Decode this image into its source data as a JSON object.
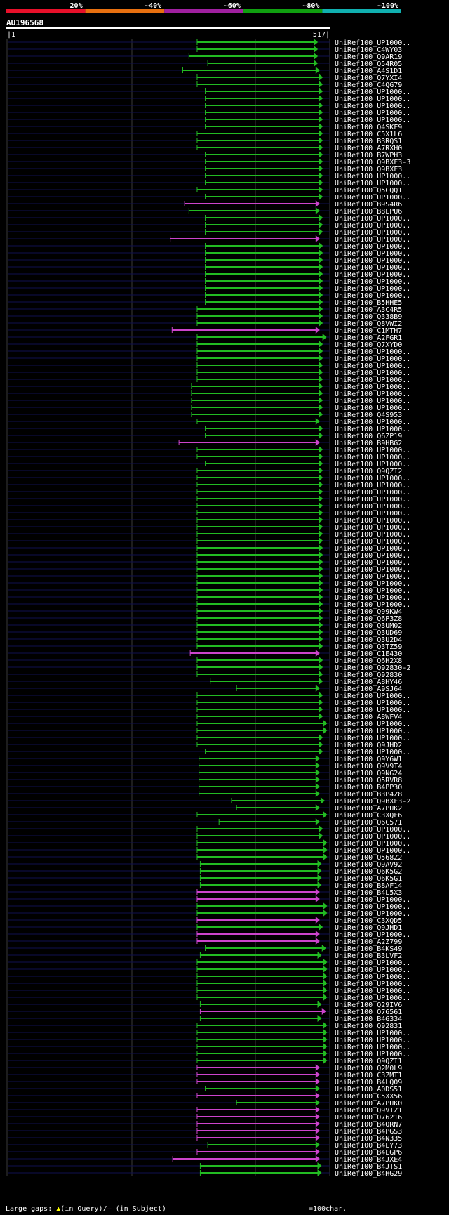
{
  "chart_data": {
    "type": "alignment_overview",
    "title": "AU196568",
    "query_start": "1",
    "query_end": "517",
    "scale_labels": [
      "20%",
      "~40%",
      "~60%",
      "~80%",
      "~100%"
    ],
    "scale_colors": [
      "#e8102a",
      "#e87010",
      "#a020a0",
      "#10a010",
      "#10b0b0"
    ],
    "hit_colors": {
      "green": "#22bb22",
      "magenta": "#cc44cc"
    },
    "rows": [
      {
        "name": "UniRef100_UP1000..",
        "s": 305,
        "e": 497,
        "c": "g"
      },
      {
        "name": "UniRef100_C4WY03",
        "s": 305,
        "e": 497,
        "c": "g"
      },
      {
        "name": "UniRef100_Q9AR19",
        "s": 292,
        "e": 497,
        "c": "g"
      },
      {
        "name": "UniRef100_Q54R05",
        "s": 322,
        "e": 497,
        "c": "g"
      },
      {
        "name": "UniRef100_A4S1D1",
        "s": 282,
        "e": 500,
        "c": "g"
      },
      {
        "name": "UniRef100_Q7YXI4",
        "s": 305,
        "e": 505,
        "c": "g"
      },
      {
        "name": "UniRef100_C4QG79",
        "s": 305,
        "e": 505,
        "c": "g"
      },
      {
        "name": "UniRef100_UP1000..",
        "s": 318,
        "e": 505,
        "c": "g"
      },
      {
        "name": "UniRef100_UP1000..",
        "s": 318,
        "e": 505,
        "c": "g"
      },
      {
        "name": "UniRef100_UP1000..",
        "s": 318,
        "e": 505,
        "c": "g"
      },
      {
        "name": "UniRef100_UP1000..",
        "s": 318,
        "e": 505,
        "c": "g"
      },
      {
        "name": "UniRef100_UP1000..",
        "s": 318,
        "e": 505,
        "c": "g"
      },
      {
        "name": "UniRef100_Q4SKF9",
        "s": 318,
        "e": 505,
        "c": "g"
      },
      {
        "name": "UniRef100_C5X1L6",
        "s": 305,
        "e": 505,
        "c": "g"
      },
      {
        "name": "UniRef100_B3RQS1",
        "s": 305,
        "e": 505,
        "c": "g"
      },
      {
        "name": "UniRef100_A7RXH0",
        "s": 305,
        "e": 505,
        "c": "g"
      },
      {
        "name": "UniRef100_B7WPH3",
        "s": 318,
        "e": 505,
        "c": "g"
      },
      {
        "name": "UniRef100_Q9BXF3-3",
        "s": 318,
        "e": 505,
        "c": "g"
      },
      {
        "name": "UniRef100_Q9BXF3",
        "s": 318,
        "e": 505,
        "c": "g"
      },
      {
        "name": "UniRef100_UP1000..",
        "s": 318,
        "e": 505,
        "c": "g"
      },
      {
        "name": "UniRef100_UP1000..",
        "s": 318,
        "e": 505,
        "c": "g"
      },
      {
        "name": "UniRef100_Q5CQQ1",
        "s": 305,
        "e": 505,
        "c": "g"
      },
      {
        "name": "UniRef100_UP1000..",
        "s": 318,
        "e": 505,
        "c": "g"
      },
      {
        "name": "UniRef100_B9S4R6",
        "s": 285,
        "e": 500,
        "c": "m"
      },
      {
        "name": "UniRef100_B8LPU6",
        "s": 292,
        "e": 500,
        "c": "g"
      },
      {
        "name": "UniRef100_UP1000..",
        "s": 318,
        "e": 505,
        "c": "g"
      },
      {
        "name": "UniRef100_UP1000..",
        "s": 318,
        "e": 505,
        "c": "g"
      },
      {
        "name": "UniRef100_UP1000..",
        "s": 318,
        "e": 505,
        "c": "g"
      },
      {
        "name": "UniRef100_UP1000..",
        "s": 262,
        "e": 500,
        "c": "m"
      },
      {
        "name": "UniRef100_UP1000..",
        "s": 318,
        "e": 505,
        "c": "g"
      },
      {
        "name": "UniRef100_UP1000..",
        "s": 318,
        "e": 505,
        "c": "g"
      },
      {
        "name": "UniRef100_UP1000..",
        "s": 318,
        "e": 505,
        "c": "g"
      },
      {
        "name": "UniRef100_UP1000..",
        "s": 318,
        "e": 505,
        "c": "g"
      },
      {
        "name": "UniRef100_UP1000..",
        "s": 318,
        "e": 505,
        "c": "g"
      },
      {
        "name": "UniRef100_UP1000..",
        "s": 318,
        "e": 505,
        "c": "g"
      },
      {
        "name": "UniRef100_UP1000..",
        "s": 318,
        "e": 505,
        "c": "g"
      },
      {
        "name": "UniRef100_UP1000..",
        "s": 318,
        "e": 505,
        "c": "g"
      },
      {
        "name": "UniRef100_B5HHE5",
        "s": 318,
        "e": 505,
        "c": "g"
      },
      {
        "name": "UniRef100_A3C4R5",
        "s": 305,
        "e": 505,
        "c": "g"
      },
      {
        "name": "UniRef100_Q338B9",
        "s": 305,
        "e": 505,
        "c": "g"
      },
      {
        "name": "UniRef100_Q8VWI2",
        "s": 305,
        "e": 505,
        "c": "g"
      },
      {
        "name": "UniRef100_C1MTH7",
        "s": 265,
        "e": 500,
        "c": "m"
      },
      {
        "name": "UniRef100_A2FGR1",
        "s": 305,
        "e": 511,
        "c": "g"
      },
      {
        "name": "UniRef100_Q7XYD0",
        "s": 305,
        "e": 505,
        "c": "g"
      },
      {
        "name": "UniRef100_UP1000..",
        "s": 305,
        "e": 505,
        "c": "g"
      },
      {
        "name": "UniRef100_UP1000..",
        "s": 305,
        "e": 505,
        "c": "g"
      },
      {
        "name": "UniRef100_UP1000..",
        "s": 305,
        "e": 505,
        "c": "g"
      },
      {
        "name": "UniRef100_UP1000..",
        "s": 305,
        "e": 505,
        "c": "g"
      },
      {
        "name": "UniRef100_UP1000..",
        "s": 305,
        "e": 505,
        "c": "g"
      },
      {
        "name": "UniRef100_UP1000..",
        "s": 296,
        "e": 505,
        "c": "g"
      },
      {
        "name": "UniRef100_UP1000..",
        "s": 296,
        "e": 505,
        "c": "g"
      },
      {
        "name": "UniRef100_UP1000..",
        "s": 296,
        "e": 505,
        "c": "g"
      },
      {
        "name": "UniRef100_UP1000..",
        "s": 296,
        "e": 505,
        "c": "g"
      },
      {
        "name": "UniRef100_Q4S953",
        "s": 296,
        "e": 505,
        "c": "g"
      },
      {
        "name": "UniRef100_UP1000..",
        "s": 305,
        "e": 500,
        "c": "g"
      },
      {
        "name": "UniRef100_UP1000..",
        "s": 318,
        "e": 505,
        "c": "g"
      },
      {
        "name": "UniRef100_Q6ZP19",
        "s": 318,
        "e": 505,
        "c": "g"
      },
      {
        "name": "UniRef100_B9HBG2",
        "s": 276,
        "e": 500,
        "c": "m"
      },
      {
        "name": "UniRef100_UP1000..",
        "s": 305,
        "e": 505,
        "c": "g"
      },
      {
        "name": "UniRef100_UP1000..",
        "s": 305,
        "e": 505,
        "c": "g"
      },
      {
        "name": "UniRef100_UP1000..",
        "s": 318,
        "e": 505,
        "c": "g"
      },
      {
        "name": "UniRef100_Q9QZI2",
        "s": 305,
        "e": 505,
        "c": "g"
      },
      {
        "name": "UniRef100_UP1000..",
        "s": 305,
        "e": 505,
        "c": "g"
      },
      {
        "name": "UniRef100_UP1000..",
        "s": 305,
        "e": 505,
        "c": "g"
      },
      {
        "name": "UniRef100_UP1000..",
        "s": 305,
        "e": 505,
        "c": "g"
      },
      {
        "name": "UniRef100_UP1000..",
        "s": 305,
        "e": 505,
        "c": "g"
      },
      {
        "name": "UniRef100_UP1000..",
        "s": 305,
        "e": 505,
        "c": "g"
      },
      {
        "name": "UniRef100_UP1000..",
        "s": 305,
        "e": 505,
        "c": "g"
      },
      {
        "name": "UniRef100_UP1000..",
        "s": 305,
        "e": 505,
        "c": "g"
      },
      {
        "name": "UniRef100_UP1000..",
        "s": 305,
        "e": 505,
        "c": "g"
      },
      {
        "name": "UniRef100_UP1000..",
        "s": 305,
        "e": 505,
        "c": "g"
      },
      {
        "name": "UniRef100_UP1000..",
        "s": 305,
        "e": 505,
        "c": "g"
      },
      {
        "name": "UniRef100_UP1000..",
        "s": 305,
        "e": 505,
        "c": "g"
      },
      {
        "name": "UniRef100_UP1000..",
        "s": 305,
        "e": 505,
        "c": "g"
      },
      {
        "name": "UniRef100_UP1000..",
        "s": 305,
        "e": 505,
        "c": "g"
      },
      {
        "name": "UniRef100_UP1000..",
        "s": 305,
        "e": 505,
        "c": "g"
      },
      {
        "name": "UniRef100_UP1000..",
        "s": 305,
        "e": 505,
        "c": "g"
      },
      {
        "name": "UniRef100_UP1000..",
        "s": 305,
        "e": 505,
        "c": "g"
      },
      {
        "name": "UniRef100_UP1000..",
        "s": 305,
        "e": 505,
        "c": "g"
      },
      {
        "name": "UniRef100_UP1000..",
        "s": 305,
        "e": 505,
        "c": "g"
      },
      {
        "name": "UniRef100_UP1000..",
        "s": 305,
        "e": 505,
        "c": "g"
      },
      {
        "name": "UniRef100_Q99KW4",
        "s": 305,
        "e": 505,
        "c": "g"
      },
      {
        "name": "UniRef100_Q6P3Z8",
        "s": 305,
        "e": 505,
        "c": "g"
      },
      {
        "name": "UniRef100_Q3UM02",
        "s": 305,
        "e": 505,
        "c": "g"
      },
      {
        "name": "UniRef100_Q3UD69",
        "s": 305,
        "e": 505,
        "c": "g"
      },
      {
        "name": "UniRef100_Q3U2D4",
        "s": 305,
        "e": 505,
        "c": "g"
      },
      {
        "name": "UniRef100_Q3TZ59",
        "s": 305,
        "e": 505,
        "c": "g"
      },
      {
        "name": "UniRef100_C1E430",
        "s": 294,
        "e": 500,
        "c": "m"
      },
      {
        "name": "UniRef100_Q6H2X8",
        "s": 305,
        "e": 505,
        "c": "g"
      },
      {
        "name": "UniRef100_Q92830-2",
        "s": 305,
        "e": 505,
        "c": "g"
      },
      {
        "name": "UniRef100_Q92830",
        "s": 305,
        "e": 505,
        "c": "g"
      },
      {
        "name": "UniRef100_A8HY46",
        "s": 326,
        "e": 505,
        "c": "g"
      },
      {
        "name": "UniRef100_A9SJ64",
        "s": 368,
        "e": 500,
        "c": "g"
      },
      {
        "name": "UniRef100_UP1000..",
        "s": 305,
        "e": 505,
        "c": "g"
      },
      {
        "name": "UniRef100_UP1000..",
        "s": 305,
        "e": 505,
        "c": "g"
      },
      {
        "name": "UniRef100_UP1000..",
        "s": 305,
        "e": 505,
        "c": "g"
      },
      {
        "name": "UniRef100_A8WFV4",
        "s": 305,
        "e": 505,
        "c": "g"
      },
      {
        "name": "UniRef100_UP1000..",
        "s": 305,
        "e": 512,
        "c": "g"
      },
      {
        "name": "UniRef100_UP1000..",
        "s": 305,
        "e": 512,
        "c": "g"
      },
      {
        "name": "UniRef100_UP1000..",
        "s": 305,
        "e": 505,
        "c": "g"
      },
      {
        "name": "UniRef100_Q9JHD2",
        "s": 305,
        "e": 505,
        "c": "g"
      },
      {
        "name": "UniRef100_UP1000..",
        "s": 318,
        "e": 505,
        "c": "g"
      },
      {
        "name": "UniRef100_Q9Y6W1",
        "s": 308,
        "e": 500,
        "c": "g"
      },
      {
        "name": "UniRef100_Q9V9T4",
        "s": 308,
        "e": 500,
        "c": "g"
      },
      {
        "name": "UniRef100_Q9NG24",
        "s": 308,
        "e": 500,
        "c": "g"
      },
      {
        "name": "UniRef100_Q5RVR8",
        "s": 308,
        "e": 500,
        "c": "g"
      },
      {
        "name": "UniRef100_B4PP30",
        "s": 308,
        "e": 500,
        "c": "g"
      },
      {
        "name": "UniRef100_B3P4Z8",
        "s": 308,
        "e": 500,
        "c": "g"
      },
      {
        "name": "UniRef100_Q9BXF3-2",
        "s": 360,
        "e": 508,
        "c": "g"
      },
      {
        "name": "UniRef100_A7PUK2",
        "s": 368,
        "e": 500,
        "c": "g"
      },
      {
        "name": "UniRef100_C3XQF6",
        "s": 305,
        "e": 512,
        "c": "g"
      },
      {
        "name": "UniRef100_Q6C571",
        "s": 340,
        "e": 500,
        "c": "g"
      },
      {
        "name": "UniRef100_UP1000..",
        "s": 305,
        "e": 505,
        "c": "g"
      },
      {
        "name": "UniRef100_UP1000..",
        "s": 305,
        "e": 505,
        "c": "g"
      },
      {
        "name": "UniRef100_UP1000..",
        "s": 305,
        "e": 512,
        "c": "g"
      },
      {
        "name": "UniRef100_UP1000..",
        "s": 305,
        "e": 512,
        "c": "g"
      },
      {
        "name": "UniRef100_Q568Z2",
        "s": 305,
        "e": 512,
        "c": "g"
      },
      {
        "name": "UniRef100_Q9AV92",
        "s": 310,
        "e": 503,
        "c": "g"
      },
      {
        "name": "UniRef100_Q6K5G2",
        "s": 310,
        "e": 503,
        "c": "g"
      },
      {
        "name": "UniRef100_Q6K5G1",
        "s": 310,
        "e": 503,
        "c": "g"
      },
      {
        "name": "UniRef100_B8AF14",
        "s": 310,
        "e": 503,
        "c": "g"
      },
      {
        "name": "UniRef100_B4L5X3",
        "s": 305,
        "e": 500,
        "c": "m"
      },
      {
        "name": "UniRef100_UP1000..",
        "s": 305,
        "e": 500,
        "c": "m"
      },
      {
        "name": "UniRef100_UP1000..",
        "s": 305,
        "e": 512,
        "c": "g"
      },
      {
        "name": "UniRef100_UP1000..",
        "s": 305,
        "e": 512,
        "c": "g"
      },
      {
        "name": "UniRef100_C3XQD5",
        "s": 305,
        "e": 500,
        "c": "m"
      },
      {
        "name": "UniRef100_Q9JHD1",
        "s": 305,
        "e": 505,
        "c": "g"
      },
      {
        "name": "UniRef100_UP1000..",
        "s": 305,
        "e": 500,
        "c": "m"
      },
      {
        "name": "UniRef100_A2Z799",
        "s": 305,
        "e": 500,
        "c": "m"
      },
      {
        "name": "UniRef100_B4KS49",
        "s": 318,
        "e": 510,
        "c": "g"
      },
      {
        "name": "UniRef100_B3LVF2",
        "s": 310,
        "e": 503,
        "c": "g"
      },
      {
        "name": "UniRef100_UP1000..",
        "s": 305,
        "e": 512,
        "c": "g"
      },
      {
        "name": "UniRef100_UP1000..",
        "s": 305,
        "e": 512,
        "c": "g"
      },
      {
        "name": "UniRef100_UP1000..",
        "s": 305,
        "e": 512,
        "c": "g"
      },
      {
        "name": "UniRef100_UP1000..",
        "s": 305,
        "e": 512,
        "c": "g"
      },
      {
        "name": "UniRef100_UP1000..",
        "s": 305,
        "e": 512,
        "c": "g"
      },
      {
        "name": "UniRef100_UP1000..",
        "s": 305,
        "e": 512,
        "c": "g"
      },
      {
        "name": "UniRef100_Q29IV6",
        "s": 310,
        "e": 503,
        "c": "g"
      },
      {
        "name": "UniRef100_O76561",
        "s": 310,
        "e": 510,
        "c": "m"
      },
      {
        "name": "UniRef100_B4G334",
        "s": 310,
        "e": 503,
        "c": "g"
      },
      {
        "name": "UniRef100_Q92831",
        "s": 305,
        "e": 512,
        "c": "g"
      },
      {
        "name": "UniRef100_UP1000..",
        "s": 305,
        "e": 512,
        "c": "g"
      },
      {
        "name": "UniRef100_UP1000..",
        "s": 305,
        "e": 512,
        "c": "g"
      },
      {
        "name": "UniRef100_UP1000..",
        "s": 305,
        "e": 512,
        "c": "g"
      },
      {
        "name": "UniRef100_UP1000..",
        "s": 305,
        "e": 512,
        "c": "g"
      },
      {
        "name": "UniRef100_Q9QZI1",
        "s": 305,
        "e": 512,
        "c": "g"
      },
      {
        "name": "UniRef100_Q2M0L9",
        "s": 305,
        "e": 500,
        "c": "m"
      },
      {
        "name": "UniRef100_C3ZMT1",
        "s": 305,
        "e": 500,
        "c": "m"
      },
      {
        "name": "UniRef100_B4LQ09",
        "s": 305,
        "e": 500,
        "c": "m"
      },
      {
        "name": "UniRef100_A0DS51",
        "s": 318,
        "e": 500,
        "c": "g"
      },
      {
        "name": "UniRef100_C5XX56",
        "s": 305,
        "e": 500,
        "c": "m"
      },
      {
        "name": "UniRef100_A7PUK0",
        "s": 368,
        "e": 500,
        "c": "g"
      },
      {
        "name": "UniRef100_Q9VTZ1",
        "s": 305,
        "e": 500,
        "c": "m"
      },
      {
        "name": "UniRef100_O76216",
        "s": 305,
        "e": 500,
        "c": "m"
      },
      {
        "name": "UniRef100_B4QRN7",
        "s": 305,
        "e": 500,
        "c": "m"
      },
      {
        "name": "UniRef100_B4PGS3",
        "s": 305,
        "e": 500,
        "c": "m"
      },
      {
        "name": "UniRef100_B4N335",
        "s": 305,
        "e": 500,
        "c": "m"
      },
      {
        "name": "UniRef100_B4LY73",
        "s": 322,
        "e": 500,
        "c": "g"
      },
      {
        "name": "UniRef100_B4LGP6",
        "s": 305,
        "e": 500,
        "c": "m"
      },
      {
        "name": "UniRef100_B4JXE4",
        "s": 266,
        "e": 500,
        "c": "m"
      },
      {
        "name": "UniRef100_B4JTS1",
        "s": 310,
        "e": 503,
        "c": "g"
      },
      {
        "name": "UniRef100_B4HG29",
        "s": 310,
        "e": 503,
        "c": "g"
      }
    ]
  },
  "footer": {
    "large_gaps": "Large gaps:",
    "in_query": "(in Query)/",
    "in_subject": "(in Subject)",
    "scale_note": "=100char."
  }
}
